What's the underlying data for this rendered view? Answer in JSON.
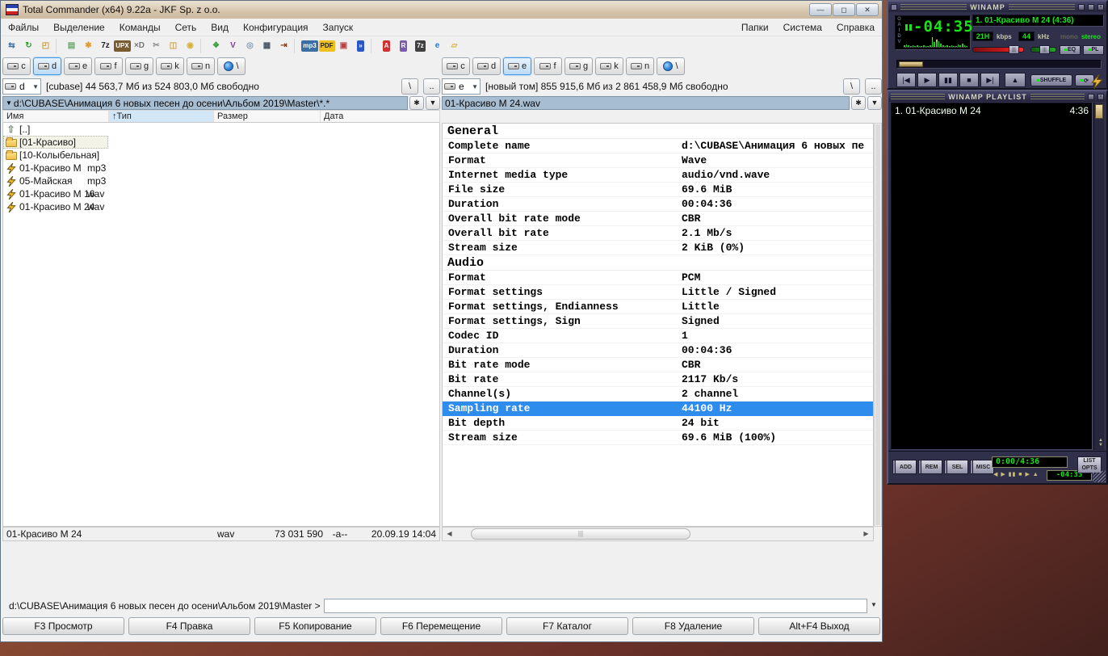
{
  "window": {
    "title": "Total Commander (x64) 9.22a - JKF Sp. z o.o.",
    "minimize": "—",
    "maximize": "◻",
    "close": "✕"
  },
  "menubar": {
    "left": [
      "Файлы",
      "Выделение",
      "Команды",
      "Сеть",
      "Вид",
      "Конфигурация",
      "Запуск"
    ],
    "right": [
      "Папки",
      "Система",
      "Справка"
    ]
  },
  "toolbar": [
    {
      "name": "ftp-connect-icon",
      "glyph": "⇆",
      "fg": "#3b6ea5"
    },
    {
      "name": "refresh-icon",
      "glyph": "↻",
      "fg": "#2e9e2e"
    },
    {
      "name": "unpack-icon",
      "glyph": "◰",
      "fg": "#c89a3e"
    },
    {
      "sep": true
    },
    {
      "name": "notepad-icon",
      "glyph": "▤",
      "fg": "#6aa86a"
    },
    {
      "name": "flower-icon",
      "glyph": "✱",
      "fg": "#e09a2e"
    },
    {
      "name": "7z-sfx-icon",
      "glyph": "7z",
      "fg": "#222222"
    },
    {
      "name": "upx-shell-icon",
      "glyph": "UPX",
      "fg": "#ffffff",
      "bg": "#7a5c32"
    },
    {
      "name": "xd-player-icon",
      "glyph": "×D",
      "fg": "#777777"
    },
    {
      "name": "tools-icon",
      "glyph": "✂",
      "fg": "#888888"
    },
    {
      "name": "exit-door-icon",
      "glyph": "◫",
      "fg": "#caa54e"
    },
    {
      "name": "gold-cd-icon",
      "glyph": "◉",
      "fg": "#d4b23a"
    },
    {
      "sep": true
    },
    {
      "name": "green-app-icon",
      "glyph": "❖",
      "fg": "#3e9e3e"
    },
    {
      "name": "purple-v-icon",
      "glyph": "V",
      "fg": "#8040a0"
    },
    {
      "name": "cd-disc-icon",
      "glyph": "◎",
      "fg": "#8899aa"
    },
    {
      "name": "table-list-icon",
      "glyph": "▦",
      "fg": "#445566"
    },
    {
      "name": "goto-line-icon",
      "glyph": "⇥",
      "fg": "#884422"
    },
    {
      "sep": true
    },
    {
      "name": "mp3-tool-icon",
      "glyph": "mp3",
      "fg": "#ffffff",
      "bg": "#3b6ea5"
    },
    {
      "name": "pdf-icon",
      "glyph": "PDF",
      "fg": "#222222",
      "bg": "#f0c020"
    },
    {
      "name": "image-tool-icon",
      "glyph": "▣",
      "fg": "#c04040"
    },
    {
      "name": "double-chevron-icon",
      "glyph": "»",
      "fg": "#ffffff",
      "bg": "#2a56c8"
    },
    {
      "sep": true
    },
    {
      "name": "letter-a-icon",
      "glyph": "A",
      "fg": "#ffffff",
      "bg": "#d03030"
    },
    {
      "name": "winrar-icon",
      "glyph": "R",
      "fg": "#ffffff",
      "bg": "#7a5aaa"
    },
    {
      "name": "7zip-icon",
      "glyph": "7z",
      "fg": "#ffffff",
      "bg": "#404040"
    },
    {
      "name": "ie-icon",
      "glyph": "e",
      "fg": "#2277dd"
    },
    {
      "name": "folder-icon",
      "glyph": "▱",
      "fg": "#e0a830"
    }
  ],
  "panels": {
    "left": {
      "drives": [
        {
          "letter": "c"
        },
        {
          "letter": "d",
          "active": true
        },
        {
          "letter": "e"
        },
        {
          "letter": "f"
        },
        {
          "letter": "g"
        },
        {
          "letter": "k"
        },
        {
          "letter": "n",
          "icon": "network"
        },
        {
          "letter": "\\",
          "icon": "globe"
        }
      ],
      "drive_selector": "d",
      "drive_info": "[cubase]  44 563,7 Мб из 524 803,0 Мб свободно",
      "root_button": "\\",
      "up_button": "..",
      "path_prefix": "▼",
      "path": "d:\\CUBASE\\Анимация 6 новых песен до осени\\Альбом 2019\\Master\\*.*",
      "star_button": "✱",
      "menu_button": "▼",
      "columns": [
        {
          "label": "Имя",
          "sorted": ""
        },
        {
          "label": "Тип",
          "sorted": "↑"
        },
        {
          "label": "Размер",
          "sorted": ""
        },
        {
          "label": "Дата",
          "sorted": ""
        }
      ],
      "files": [
        {
          "icon": "up",
          "name": "[..]",
          "ext": ""
        },
        {
          "icon": "folder",
          "name": "[01-Красиво]",
          "ext": "",
          "cursor": true
        },
        {
          "icon": "folder",
          "name": "[10-Колыбельная]",
          "ext": ""
        },
        {
          "icon": "audio",
          "name": "01-Красиво М",
          "ext": "mp3"
        },
        {
          "icon": "audio",
          "name": "05-Майская",
          "ext": "mp3"
        },
        {
          "icon": "audio",
          "name": "01-Красиво М 16",
          "ext": "wav"
        },
        {
          "icon": "audio",
          "name": "01-Красиво М 24",
          "ext": "wav"
        }
      ],
      "status": {
        "name": "01-Красиво М 24",
        "ext": "wav",
        "size": "73 031 590",
        "attrs": "-a--",
        "date": "20.09.19 14:04"
      }
    },
    "right": {
      "drives": [
        {
          "letter": "c"
        },
        {
          "letter": "d"
        },
        {
          "letter": "e",
          "active": true
        },
        {
          "letter": "f"
        },
        {
          "letter": "g"
        },
        {
          "letter": "k"
        },
        {
          "letter": "n",
          "icon": "network"
        },
        {
          "letter": "\\",
          "icon": "globe"
        }
      ],
      "drive_selector": "e",
      "drive_info": "[новый том]  855 915,6 Мб из 2 861 458,9 Мб свободно",
      "root_button": "\\",
      "up_button": "..",
      "path": "01-Красиво М 24.wav",
      "star_button": "✱",
      "menu_button": "▼",
      "info_sections": [
        {
          "title": "General",
          "rows": [
            {
              "label": "Complete name",
              "value": "d:\\CUBASE\\Анимация 6 новых пе"
            },
            {
              "label": "Format",
              "value": "Wave"
            },
            {
              "label": "Internet media type",
              "value": "audio/vnd.wave"
            },
            {
              "label": "File size",
              "value": "69.6 MiB"
            },
            {
              "label": "Duration",
              "value": "00:04:36"
            },
            {
              "label": "Overall bit rate mode",
              "value": "CBR"
            },
            {
              "label": "Overall bit rate",
              "value": "2.1 Mb/s"
            },
            {
              "label": "Stream size",
              "value": "2 KiB (0%)"
            }
          ]
        },
        {
          "title": "Audio",
          "rows": [
            {
              "label": "Format",
              "value": "PCM"
            },
            {
              "label": "Format settings",
              "value": "Little / Signed"
            },
            {
              "label": "Format settings, Endianness",
              "value": "Little"
            },
            {
              "label": "Format settings, Sign",
              "value": "Signed"
            },
            {
              "label": "Codec ID",
              "value": "1"
            },
            {
              "label": "Duration",
              "value": "00:04:36"
            },
            {
              "label": "Bit rate mode",
              "value": "CBR"
            },
            {
              "label": "Bit rate",
              "value": "2117 Kb/s"
            },
            {
              "label": "Channel(s)",
              "value": "2 channel"
            },
            {
              "label": "Sampling rate",
              "value": "44100 Hz",
              "selected": true
            },
            {
              "label": "Bit depth",
              "value": "24 bit"
            },
            {
              "label": "Stream size",
              "value": "69.6 MiB (100%)"
            }
          ]
        }
      ]
    }
  },
  "cmdline": {
    "prompt": "d:\\CUBASE\\Анимация 6 новых песен до осени\\Альбом 2019\\Master >",
    "dropdown": "▼"
  },
  "fbuttons": [
    "F3 Просмотр",
    "F4 Правка",
    "F5 Копирование",
    "F6 Перемещение",
    "F7 Каталог",
    "F8 Удаление",
    "Alt+F4 Выход"
  ],
  "winamp": {
    "main": {
      "title": "WINAMP",
      "clutterbar": [
        "O",
        "A",
        "I",
        "D",
        "V"
      ],
      "time": "-04:35",
      "spectrum": [
        2,
        3,
        2,
        1,
        2,
        1,
        2,
        1,
        1,
        2,
        1,
        1,
        2,
        12,
        6,
        9,
        7,
        4,
        2,
        1,
        2,
        1,
        2,
        1,
        1,
        3,
        2,
        4,
        2,
        1
      ],
      "track": "1. 01-Красиво М 24 (4:36)",
      "bitrate": "21H",
      "bitrate_label": "kbps",
      "samplerate": "44",
      "samplerate_label": "kHz",
      "mono_label": "mono",
      "stereo_label": "stereo",
      "eq_label": "EQ",
      "pl_label": "PL",
      "transport": [
        "|◀",
        "▶",
        "▮▮",
        "■",
        "▶|"
      ],
      "eject": "▲",
      "shuffle_label": "SHUFFLE",
      "repeat_glyph": "⟳"
    },
    "playlist": {
      "title": "WINAMP PLAYLIST",
      "items": [
        {
          "label": "1. 01-Красиво М 24",
          "time": "4:36"
        }
      ],
      "buttons": [
        "ADD",
        "REM",
        "SEL",
        "MISC"
      ],
      "counter": "0:00/4:36",
      "mini_transport": "◀ ▶ ▮▮ ■ ▶ ▲",
      "remaining": "-04:35",
      "listopts_line1": "LIST",
      "listopts_line2": "OPTS",
      "scroll_up": "▲",
      "scroll_down": "▼"
    }
  },
  "colors": {
    "selection": "#2e8cec",
    "lcd_green": "#17e417",
    "path_bar": "#a6bdd2",
    "titlebar_tan": "#d6c5ad"
  }
}
